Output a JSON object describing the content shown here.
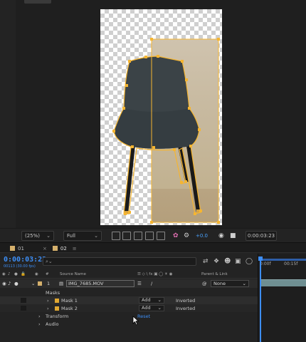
{
  "viewer": {
    "zoom": "(25%)",
    "resolution": "Full",
    "exposure": "+0.0",
    "current_time": "0:00:03:23"
  },
  "timeline": {
    "tabs": [
      {
        "label": "01",
        "active": false
      },
      {
        "label": "02",
        "active": true
      }
    ],
    "timecode": "0:00:03:23",
    "fps": "00113 (30.00 fps)",
    "search_placeholder": "⌕⌄",
    "columns": {
      "num": "#",
      "source": "Source Name",
      "parent": "Parent & Link"
    },
    "ruler": {
      "start": "0:00f",
      "mark": "00:15f"
    },
    "layer": {
      "number": "1",
      "name": "IMG_7685.MOV",
      "parent": "None"
    },
    "masks_label": "Masks",
    "masks": [
      {
        "name": "Mask 1",
        "mode": "Add",
        "inverted": "Inverted"
      },
      {
        "name": "Mask 2",
        "mode": "Add",
        "inverted": "Inverted"
      }
    ],
    "transform_label": "Transform",
    "reset_label": "Reset",
    "audio_label": "Audio"
  },
  "colors": {
    "accent": "#3d8ef5",
    "mask_path": "#f5b531",
    "label_swatch": "#d5b06c"
  }
}
